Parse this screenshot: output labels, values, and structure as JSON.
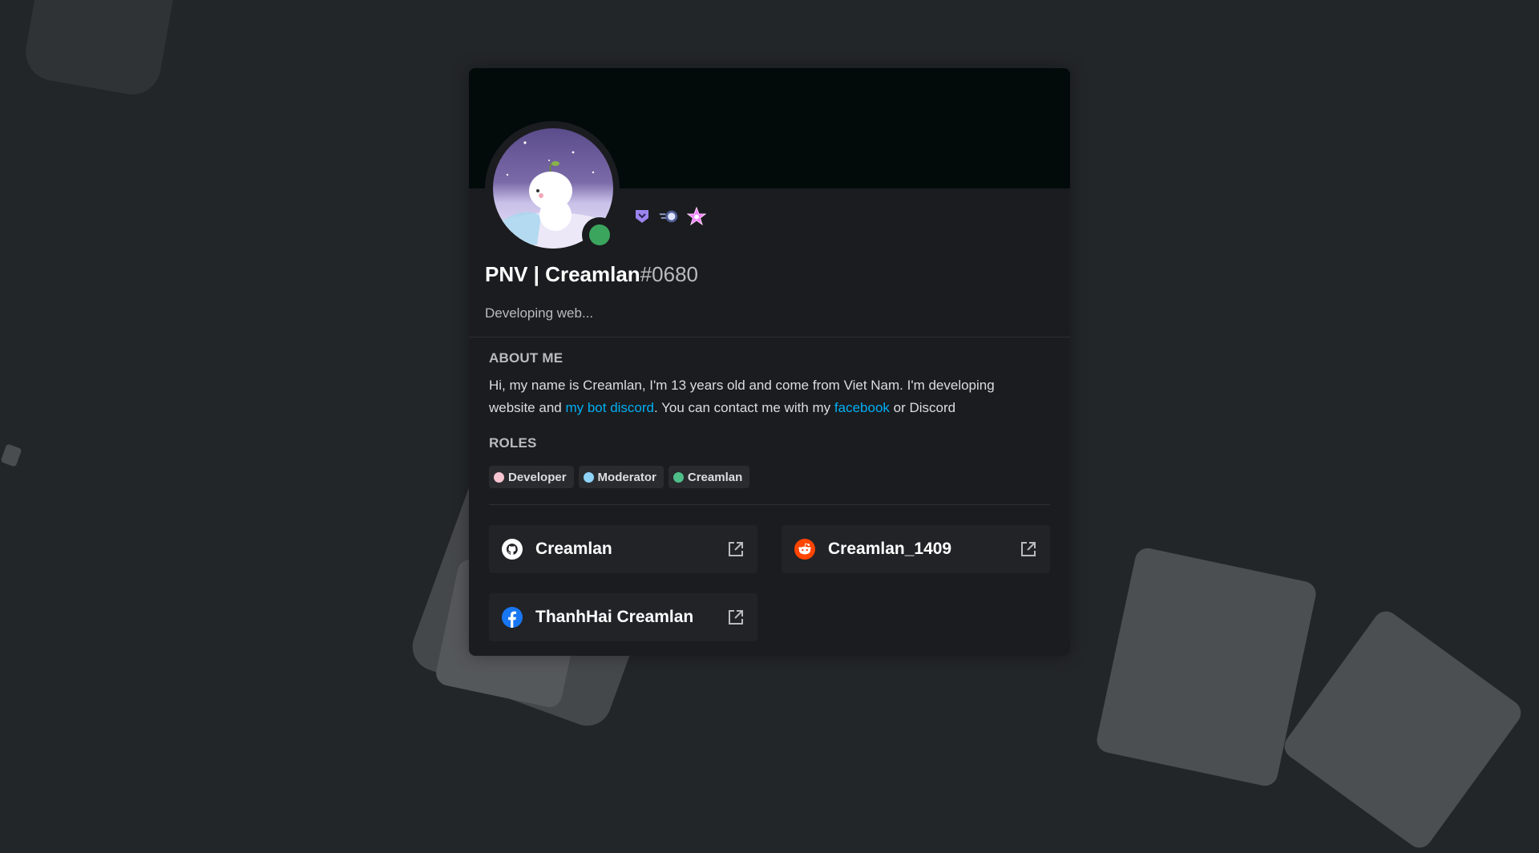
{
  "profile": {
    "username": "PNV | Creamlan",
    "discriminator": "#0680",
    "custom_status": "Developing web...",
    "status": "online",
    "status_color": "#3ba55d",
    "banner_color": "#020b09",
    "badges": [
      "hypesquad-bravery-icon",
      "early-nitro-orb-icon",
      "pink-star-icon"
    ]
  },
  "about": {
    "title": "ABOUT ME",
    "text_part1": "Hi, my name is Creamlan, I'm 13 years old and come from Viet Nam. I'm developing website and ",
    "link1": "my bot discord",
    "text_part2": ". You can contact me with my ",
    "link2": "facebook",
    "text_part3": " or Discord",
    "link_color": "#00aff4"
  },
  "roles": {
    "title": "ROLES",
    "items": [
      {
        "name": "Developer",
        "color": "#f7c5d1"
      },
      {
        "name": "Moderator",
        "color": "#8fd3f7"
      },
      {
        "name": "Creamlan",
        "color": "#4fbf8a"
      }
    ]
  },
  "connections": [
    {
      "platform": "github",
      "icon": "github-icon",
      "name": "Creamlan"
    },
    {
      "platform": "reddit",
      "icon": "reddit-icon",
      "name": "Creamlan_1409"
    },
    {
      "platform": "facebook",
      "icon": "facebook-icon",
      "name": "ThanhHai Creamlan"
    }
  ]
}
